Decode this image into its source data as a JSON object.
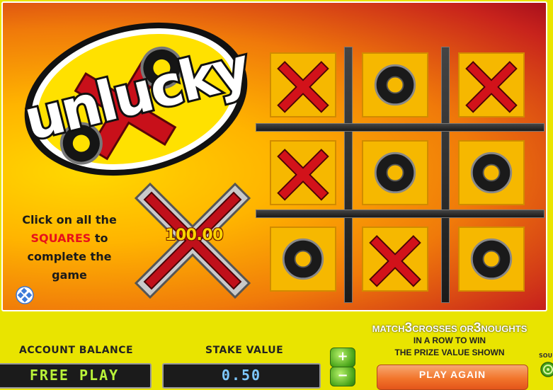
{
  "logo": {
    "text": "unlucky"
  },
  "instructions": {
    "line1": "Click on all the",
    "highlight": "SQUARES",
    "line2_suffix": " to",
    "line3": "complete the",
    "line4": "game"
  },
  "prize": {
    "value": "100.00"
  },
  "grid": {
    "cells": [
      "X",
      "O",
      "X",
      "X",
      "O",
      "O",
      "O",
      "X",
      "O"
    ]
  },
  "account": {
    "label": "ACCOUNT BALANCE",
    "value": "FREE PLAY"
  },
  "stake": {
    "label": "STAKE VALUE",
    "value": "0.50",
    "increase_label": "+",
    "decrease_label": "−"
  },
  "rules": {
    "match": "MATCH",
    "count_crosses": "3",
    "crosses_or": "CROSSES OR",
    "count_noughts": "3",
    "noughts": "NOUGHTS",
    "line2": "IN A ROW TO WIN",
    "line3": "THE PRIZE VALUE SHOWN"
  },
  "play_again": {
    "label": "PLAY AGAIN"
  },
  "sound": {
    "label": "SOU"
  },
  "icons": {
    "help": "help-grid-icon",
    "sound": "sound-icon",
    "cross": "cross-icon",
    "nought": "nought-icon"
  },
  "colors": {
    "cross_red": "#d2121a",
    "nought_black": "#1a1a1a",
    "cell_gold": "#f6b800",
    "accent_yellow": "#e9e400"
  }
}
